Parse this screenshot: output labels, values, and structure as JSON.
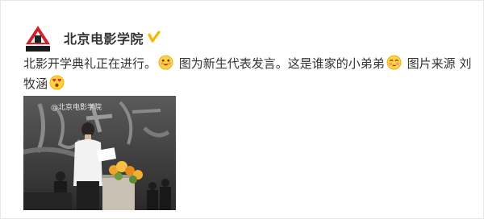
{
  "post": {
    "author": "北京电影学院",
    "verified_icon": "verified-badge-icon",
    "text_part1": "北影开学典礼正在进行。",
    "text_part2": " 图为新生代表发言。这是谁家的小弟弟",
    "text_part3": " 图片来源 刘牧涵",
    "emojis": [
      "grin-emoji",
      "blush-emoji",
      "heart-eyes-emoji"
    ],
    "image_alt": "opening-ceremony-photo",
    "image_watermark": "@北京电影学院"
  },
  "colors": {
    "accent_red": "#d0202a",
    "verified_gold": "#f5b800",
    "text": "#333333"
  }
}
